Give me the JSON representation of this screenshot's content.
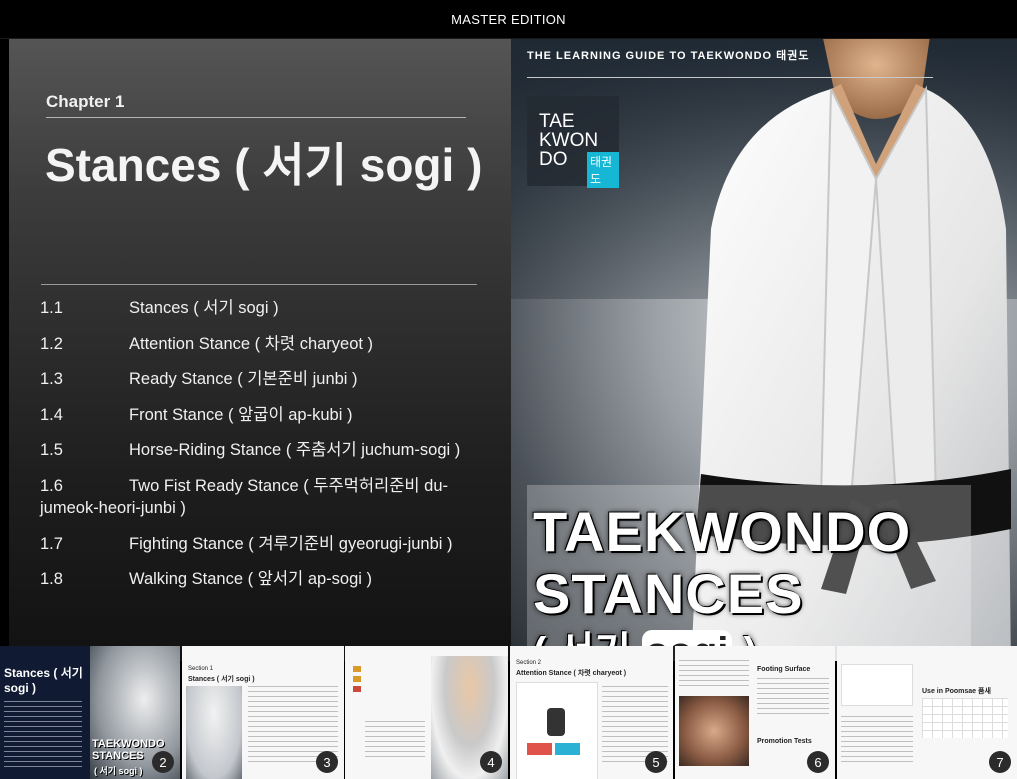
{
  "topbar": {
    "title": "MASTER EDITION"
  },
  "left_page": {
    "chapter_label": "Chapter 1",
    "chapter_title": "Stances ( 서기 sogi )",
    "toc": [
      {
        "num": "1.1",
        "text": "Stances ( 서기 sogi )"
      },
      {
        "num": "1.2",
        "text": "Attention Stance ( 차렷 charyeot )"
      },
      {
        "num": "1.3",
        "text": "Ready Stance ( 기본준비 junbi )"
      },
      {
        "num": "1.4",
        "text": "Front Stance ( 앞굽이 ap-kubi )"
      },
      {
        "num": "1.5",
        "text": "Horse-Riding Stance ( 주춤서기 juchum-sogi )"
      },
      {
        "num": "1.6",
        "text": "Two Fist Ready Stance ( 두주먹허리준비 du-jumeok-heori-junbi )"
      },
      {
        "num": "1.7",
        "text": "Fighting Stance ( 겨루기준비 gyeorugi-junbi )"
      },
      {
        "num": "1.8",
        "text": "Walking Stance ( 앞서기 ap-sogi )"
      }
    ]
  },
  "cover": {
    "header": "THE LEARNING GUIDE TO TAEKWONDO 태권도",
    "logo_lines": [
      "TAE",
      "KWON",
      "DO"
    ],
    "logo_korean": "태권도",
    "title_line1": "TAEKWONDO",
    "title_line2": "STANCES",
    "title_line3_prefix": "( 서기 ",
    "title_line3_highlight": "sogi",
    "title_line3_suffix": " )"
  },
  "thumbnails": [
    {
      "num": "2",
      "heading": "Stances ( 서기 sogi )",
      "cover_title": "TAEKWONDO STANCES",
      "cover_sub": "( 서기 sogi )"
    },
    {
      "num": "3",
      "heading": "Stances ( 서기 sogi )",
      "label": "Section 1"
    },
    {
      "num": "4"
    },
    {
      "num": "5",
      "heading": "Attention Stance ( 차렷 charyeot )",
      "label": "Section 2"
    },
    {
      "num": "6",
      "heading": "Footing Surface",
      "subheading": "Promotion Tests"
    },
    {
      "num": "7",
      "heading": "Use in Poomsae 품새"
    }
  ]
}
